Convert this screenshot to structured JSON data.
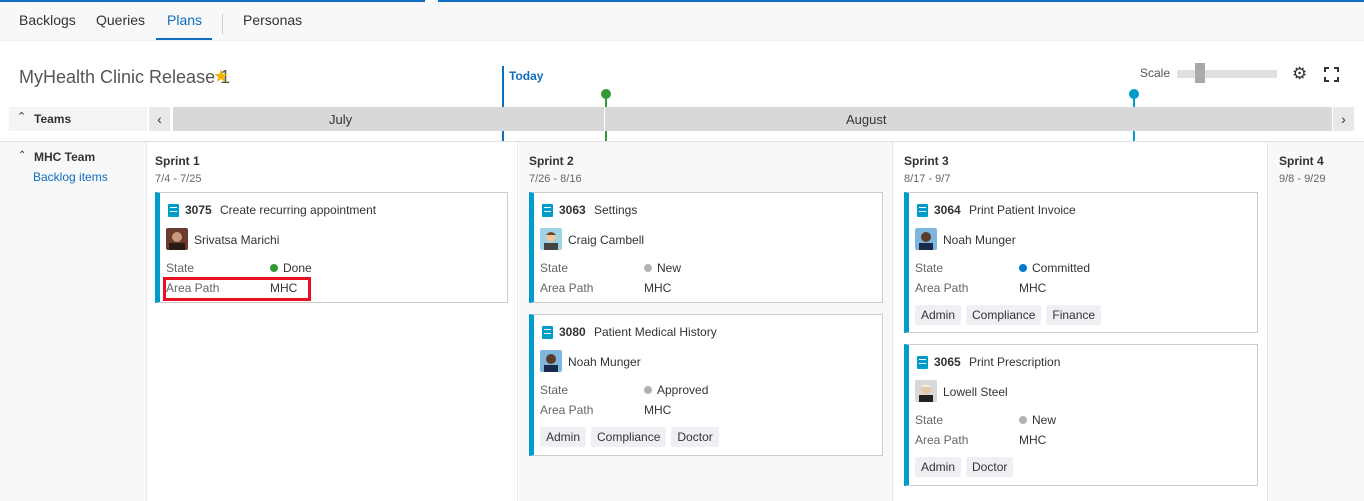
{
  "nav": {
    "tabs": [
      {
        "label": "Backlogs"
      },
      {
        "label": "Queries"
      },
      {
        "label": "Plans"
      },
      {
        "label": "Personas"
      }
    ]
  },
  "plan": {
    "title": "MyHealth Clinic Release 1",
    "favorite_icon": "star-icon"
  },
  "timeline": {
    "today_label": "Today",
    "scale_label": "Scale",
    "scale_level": 0.2,
    "teams_label": "Teams",
    "months": [
      {
        "label": "July"
      },
      {
        "label": "August"
      }
    ],
    "milestone_colors": [
      "#339933",
      "#009ccc"
    ],
    "accent_color": "#106ebe"
  },
  "team": {
    "name": "MHC Team",
    "link": "Backlog items"
  },
  "labels": {
    "state": "State",
    "area_path": "Area Path"
  },
  "sprints": [
    {
      "name": "Sprint 1",
      "dates": "7/4 - 7/25"
    },
    {
      "name": "Sprint 2",
      "dates": "7/26 - 8/16"
    },
    {
      "name": "Sprint 3",
      "dates": "8/17 - 9/7"
    },
    {
      "name": "Sprint 4",
      "dates": "9/8 - 9/29"
    }
  ],
  "cards": [
    {
      "id": "3075",
      "title": "Create recurring appointment",
      "person": "Srivatsa Marichi",
      "state": "Done",
      "state_color": "#339933",
      "area": "MHC",
      "tags": []
    },
    {
      "id": "3063",
      "title": "Settings",
      "person": "Craig Cambell",
      "state": "New",
      "state_color": "#b2b2b2",
      "area": "MHC",
      "tags": []
    },
    {
      "id": "3080",
      "title": "Patient Medical History",
      "person": "Noah Munger",
      "state": "Approved",
      "state_color": "#b2b2b2",
      "area": "MHC",
      "tags": [
        "Admin",
        "Compliance",
        "Doctor"
      ]
    },
    {
      "id": "3064",
      "title": "Print Patient Invoice",
      "person": "Noah Munger",
      "state": "Committed",
      "state_color": "#007acc",
      "area": "MHC",
      "tags": [
        "Admin",
        "Compliance",
        "Finance"
      ]
    },
    {
      "id": "3065",
      "title": "Print Prescription",
      "person": "Lowell Steel",
      "state": "New",
      "state_color": "#b2b2b2",
      "area": "MHC",
      "tags": [
        "Admin",
        "Doctor"
      ]
    }
  ]
}
